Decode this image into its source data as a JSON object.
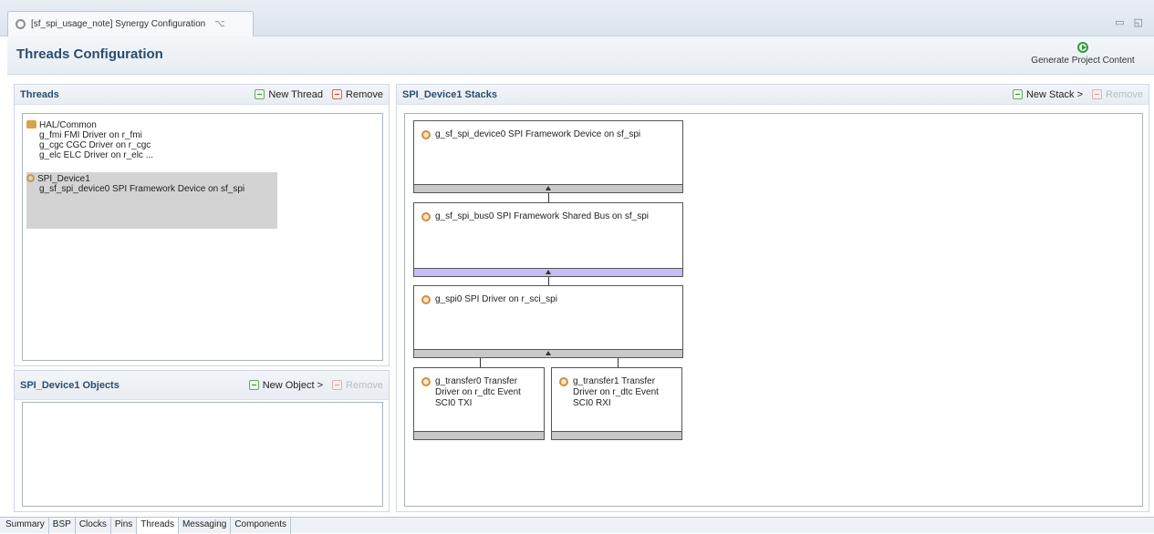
{
  "editor_tab": {
    "label": "[sf_spi_usage_note] Synergy Configuration",
    "close_glyph": "⌥"
  },
  "window_controls": {
    "minimize": "▭",
    "maximize": "◱"
  },
  "header": {
    "title": "Threads Configuration",
    "generate_label": "Generate Project Content"
  },
  "threads_panel": {
    "title": "Threads",
    "new_label": "New Thread",
    "remove_label": "Remove",
    "tree": [
      {
        "label": "HAL/Common",
        "kind": "group"
      },
      {
        "label": "g_fmi FMI Driver on r_fmi",
        "kind": "child"
      },
      {
        "label": "g_cgc CGC Driver on r_cgc",
        "kind": "child"
      },
      {
        "label": "g_elc ELC Driver on r_elc ...",
        "kind": "child"
      },
      {
        "label": "SPI_Device1",
        "kind": "thread"
      },
      {
        "label": "g_sf_spi_device0 SPI Framework Device on sf_spi",
        "kind": "child"
      }
    ]
  },
  "objects_panel": {
    "title": "SPI_Device1 Objects",
    "new_label": "New Object >",
    "remove_label": "Remove"
  },
  "stacks_panel": {
    "title": "SPI_Device1 Stacks",
    "new_label": "New Stack >",
    "remove_label": "Remove",
    "modules": [
      {
        "label": "g_sf_spi_device0 SPI Framework Device on sf_spi"
      },
      {
        "label": "g_sf_spi_bus0 SPI Framework Shared Bus on sf_spi"
      },
      {
        "label": "g_spi0 SPI Driver on r_sci_spi"
      },
      {
        "label": "g_transfer0 Transfer Driver on r_dtc Event SCI0 TXI"
      },
      {
        "label": "g_transfer1 Transfer Driver on r_dtc Event SCI0 RXI"
      }
    ]
  },
  "bottom_tabs": [
    "Summary",
    "BSP",
    "Clocks",
    "Pins",
    "Threads",
    "Messaging",
    "Components"
  ],
  "active_bottom_tab": "Threads",
  "colors": {
    "accent": "#2a4d6e",
    "shared_bus_bar": "#c7bcf3",
    "selection": "#d3d3d3"
  }
}
